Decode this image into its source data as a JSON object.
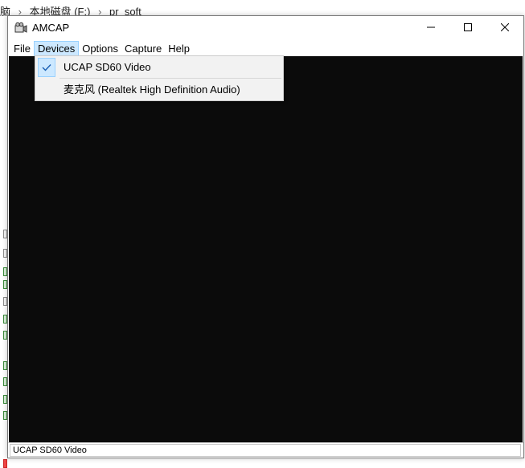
{
  "background": {
    "breadcrumb": [
      "脑",
      "›",
      "本地磁盘 (F:)",
      "›",
      "pr_soft"
    ]
  },
  "window": {
    "title": "AMCAP",
    "app_icon": "camera-icon",
    "controls": {
      "minimize_icon": "minimize-icon",
      "maximize_icon": "maximize-icon",
      "close_icon": "close-icon"
    }
  },
  "menubar": {
    "items": [
      {
        "label": "File"
      },
      {
        "label": "Devices"
      },
      {
        "label": "Options"
      },
      {
        "label": "Capture"
      },
      {
        "label": "Help"
      }
    ],
    "active": "Devices"
  },
  "devices_menu": {
    "items": [
      {
        "label": "UCAP SD60 Video",
        "checked": true
      },
      {
        "label": "麦克风 (Realtek High Definition Audio)",
        "checked": false
      }
    ]
  },
  "statusbar": {
    "text": "UCAP SD60 Video"
  },
  "colors": {
    "video_bg": "#0b0b0b",
    "menu_highlight": "#cce8ff",
    "menu_highlight_border": "#99d1ff",
    "dropdown_bg": "#f2f2f2",
    "check_color": "#1a5fb4"
  }
}
